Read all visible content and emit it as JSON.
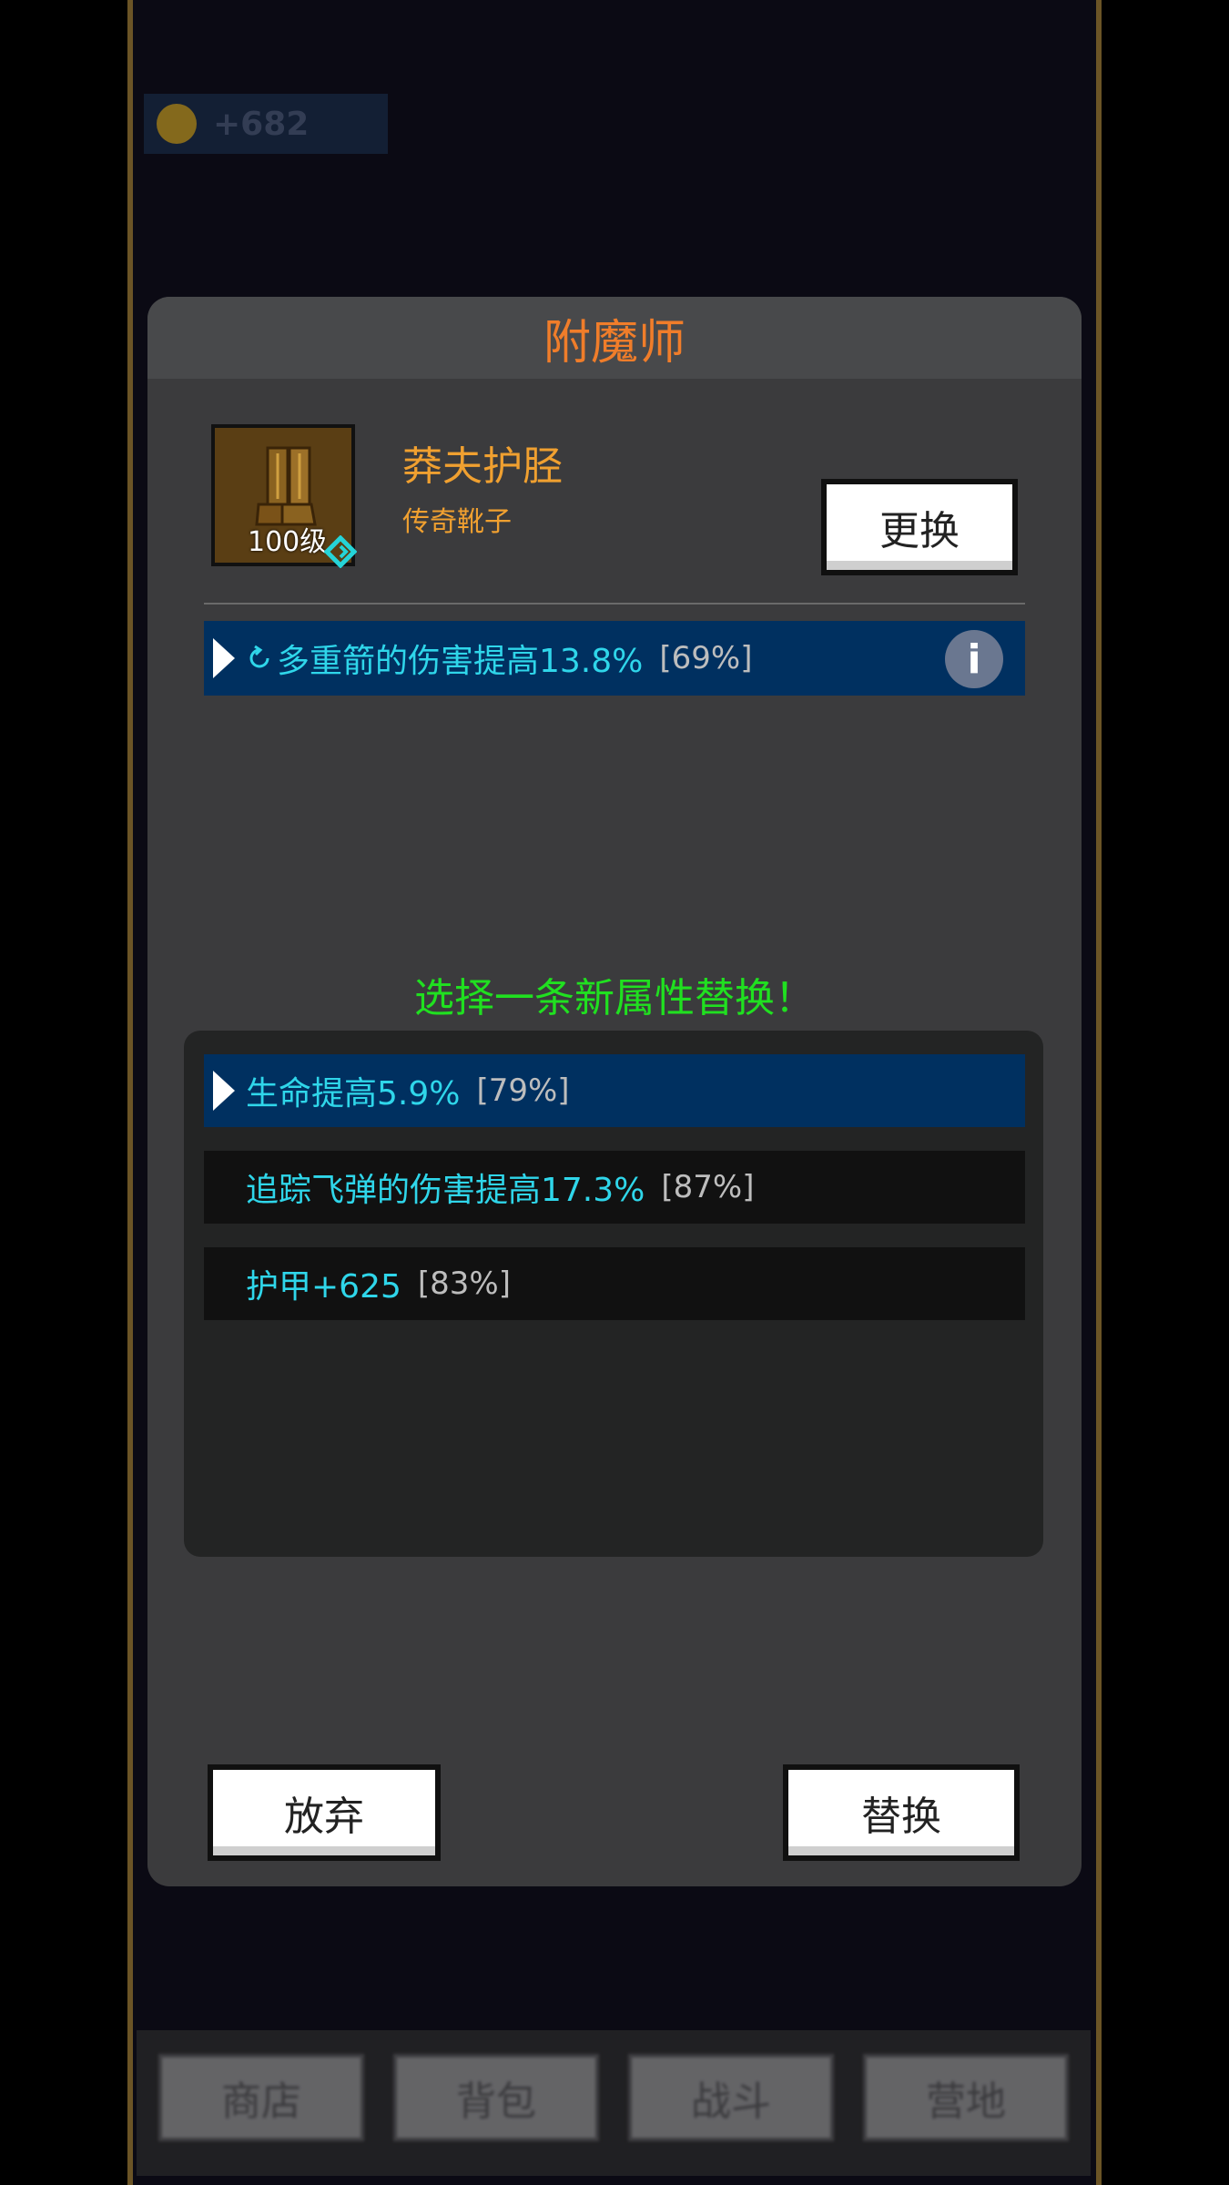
{
  "hud": {
    "coin_text": "+682"
  },
  "dialog": {
    "title": "附魔师",
    "item": {
      "level": "100级",
      "name": "莽夫护胫",
      "type": "传奇靴子"
    },
    "change_button": "更换",
    "current_attribute": {
      "text": "多重箭的伤害提高13.8%",
      "pct": "[69%]"
    },
    "prompt": "选择一条新属性替换！",
    "options": [
      {
        "text": "生命提高5.9%",
        "pct": "[79%]",
        "selected": true
      },
      {
        "text": "追踪飞弹的伤害提高17.3%",
        "pct": "[87%]",
        "selected": false
      },
      {
        "text": "护甲+625",
        "pct": "[83%]",
        "selected": false
      }
    ],
    "abandon_button": "放弃",
    "replace_button": "替换"
  },
  "nav": {
    "tabs": [
      "商店",
      "背包",
      "战斗",
      "营地"
    ]
  },
  "colors": {
    "title": "#f07d2a",
    "attr": "#2fd6ea",
    "prompt": "#20e020",
    "selected_bg": "#003060"
  }
}
